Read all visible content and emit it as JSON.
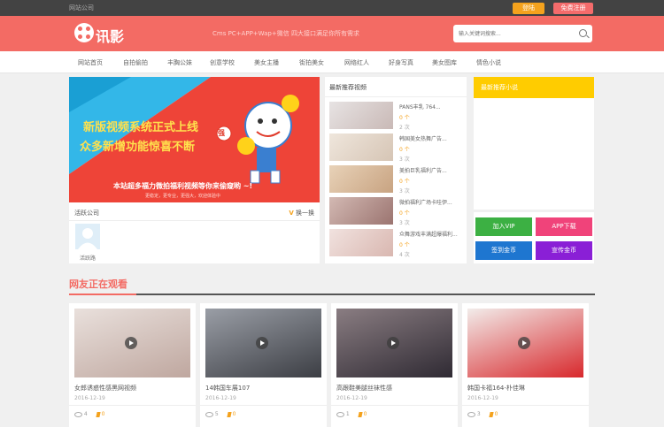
{
  "topbar": {
    "site_name": "网站公司",
    "login": "登陆",
    "register": "免费注册"
  },
  "header": {
    "logo_text": "讯影",
    "slogan": "Cms PC+APP+Wap+微信 四大接口满足你所有需求",
    "search_placeholder": "输入关键词搜索..."
  },
  "nav": [
    "网站首页",
    "自拍偷拍",
    "丰胸公妹",
    "创意学校",
    "美女主播",
    "街拍美女",
    "网络红人",
    "好身写真",
    "美女图库",
    "情色小说"
  ],
  "banner": {
    "line1": "新版视频系统正式上线",
    "line2": "众多新增功能惊喜不断",
    "sub": "本站超多福力微拍福利视频等你来偷窥哟 ~!",
    "sub2": "更稳定，更专业，更强大，欢迎体验中",
    "badge": "强"
  },
  "hot": {
    "title": "活跃公司",
    "refresh": "换一换",
    "refresh_icon": "V",
    "user": "活跃路"
  },
  "latest": {
    "title": "最新推荐视频",
    "items": [
      {
        "title": "PANS丰乳 764...",
        "coins": "0 个",
        "views": "2 次"
      },
      {
        "title": "韩国美女热舞广告...",
        "coins": "0 个",
        "views": "3 次"
      },
      {
        "title": "美拍巨乳福利广告...",
        "coins": "0 个",
        "views": "3 次"
      },
      {
        "title": "微拍福利广场卡哇伊...",
        "coins": "0 个",
        "views": "3 次"
      },
      {
        "title": "众舞游戏丰满超爆福利...",
        "coins": "0 个",
        "views": "4 次"
      }
    ]
  },
  "sidebar": {
    "title": "最新推荐小说",
    "buttons": [
      "加入VIP",
      "APP下载",
      "签到金币",
      "宣传金币"
    ],
    "colors": [
      "#3cb043",
      "#f0437a",
      "#1e76d0",
      "#8a1fd6"
    ]
  },
  "section": {
    "title": "网友正在观看"
  },
  "cards": [
    {
      "title": "女郎诱惑性感黑网视频",
      "date": "2016-12-19",
      "views": "4",
      "coins": "0"
    },
    {
      "title": "14韩国车展107",
      "date": "2016-12-19",
      "views": "5",
      "coins": "0"
    },
    {
      "title": "高跟鞋美腿丝袜性感",
      "date": "2016-12-19",
      "views": "1",
      "coins": "0"
    },
    {
      "title": "韩国卡福164-朴佳琳",
      "date": "2016-12-19",
      "views": "3",
      "coins": "0"
    }
  ],
  "colors": {
    "brand": "#f36b64",
    "accent": "#f4a21d"
  }
}
